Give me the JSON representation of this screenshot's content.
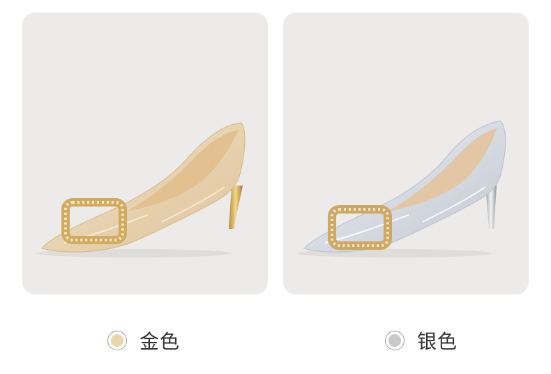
{
  "colors": {
    "card_background": "#ecebe9",
    "gold_swatch": "#e9d7aa",
    "silver_swatch": "#c9c9c9"
  },
  "options": [
    {
      "label": "金色",
      "swatch_color": "#e9d7aa"
    },
    {
      "label": "银色",
      "swatch_color": "#c9c9c9"
    }
  ]
}
